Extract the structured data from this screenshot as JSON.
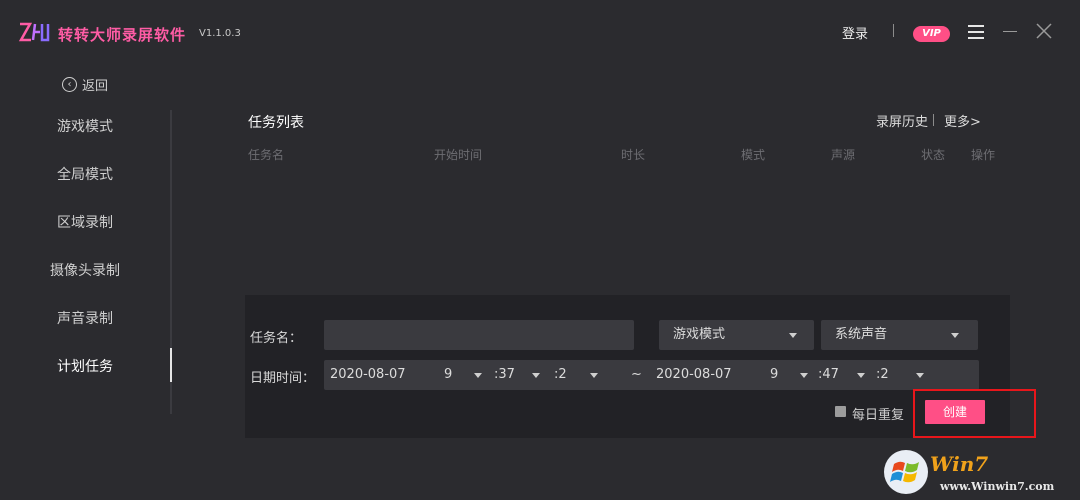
{
  "app": {
    "title": "转转大师录屏软件",
    "version": "V1.1.0.3",
    "brand_color": "#ff5ca5"
  },
  "header": {
    "login_label": "登录",
    "vip_label": "VIP",
    "menu_icon": "hamburger-icon",
    "minimize_icon": "minimize-icon",
    "close_icon": "close-icon"
  },
  "sidebar": {
    "back_label": "返回",
    "items": [
      {
        "label": "游戏模式"
      },
      {
        "label": "全局模式"
      },
      {
        "label": "区域录制"
      },
      {
        "label": "摄像头录制"
      },
      {
        "label": "声音录制"
      },
      {
        "label": "计划任务",
        "active": true
      }
    ]
  },
  "main": {
    "title": "任务列表",
    "history_label": "录屏历史",
    "more_label": "更多>",
    "columns": [
      "任务名",
      "开始时间",
      "时长",
      "模式",
      "声源",
      "状态",
      "操作"
    ]
  },
  "form": {
    "task_name_label": "任务名：",
    "task_name_value": "",
    "mode_select": "游戏模式",
    "audio_select": "系统声音",
    "datetime_label": "日期时间：",
    "start": {
      "date": "2020-08-07",
      "hour": "9",
      "minute": ":37",
      "second": ":2"
    },
    "range_sep": "~",
    "end": {
      "date": "2020-08-07",
      "hour": "9",
      "minute": ":47",
      "second": ":2"
    },
    "daily_repeat_label": "每日重复",
    "daily_repeat_checked": false,
    "create_label": "创建",
    "accent_color": "#ff4f86"
  },
  "watermark": {
    "brand": "Win7",
    "url": "www.Winwin7.com"
  }
}
